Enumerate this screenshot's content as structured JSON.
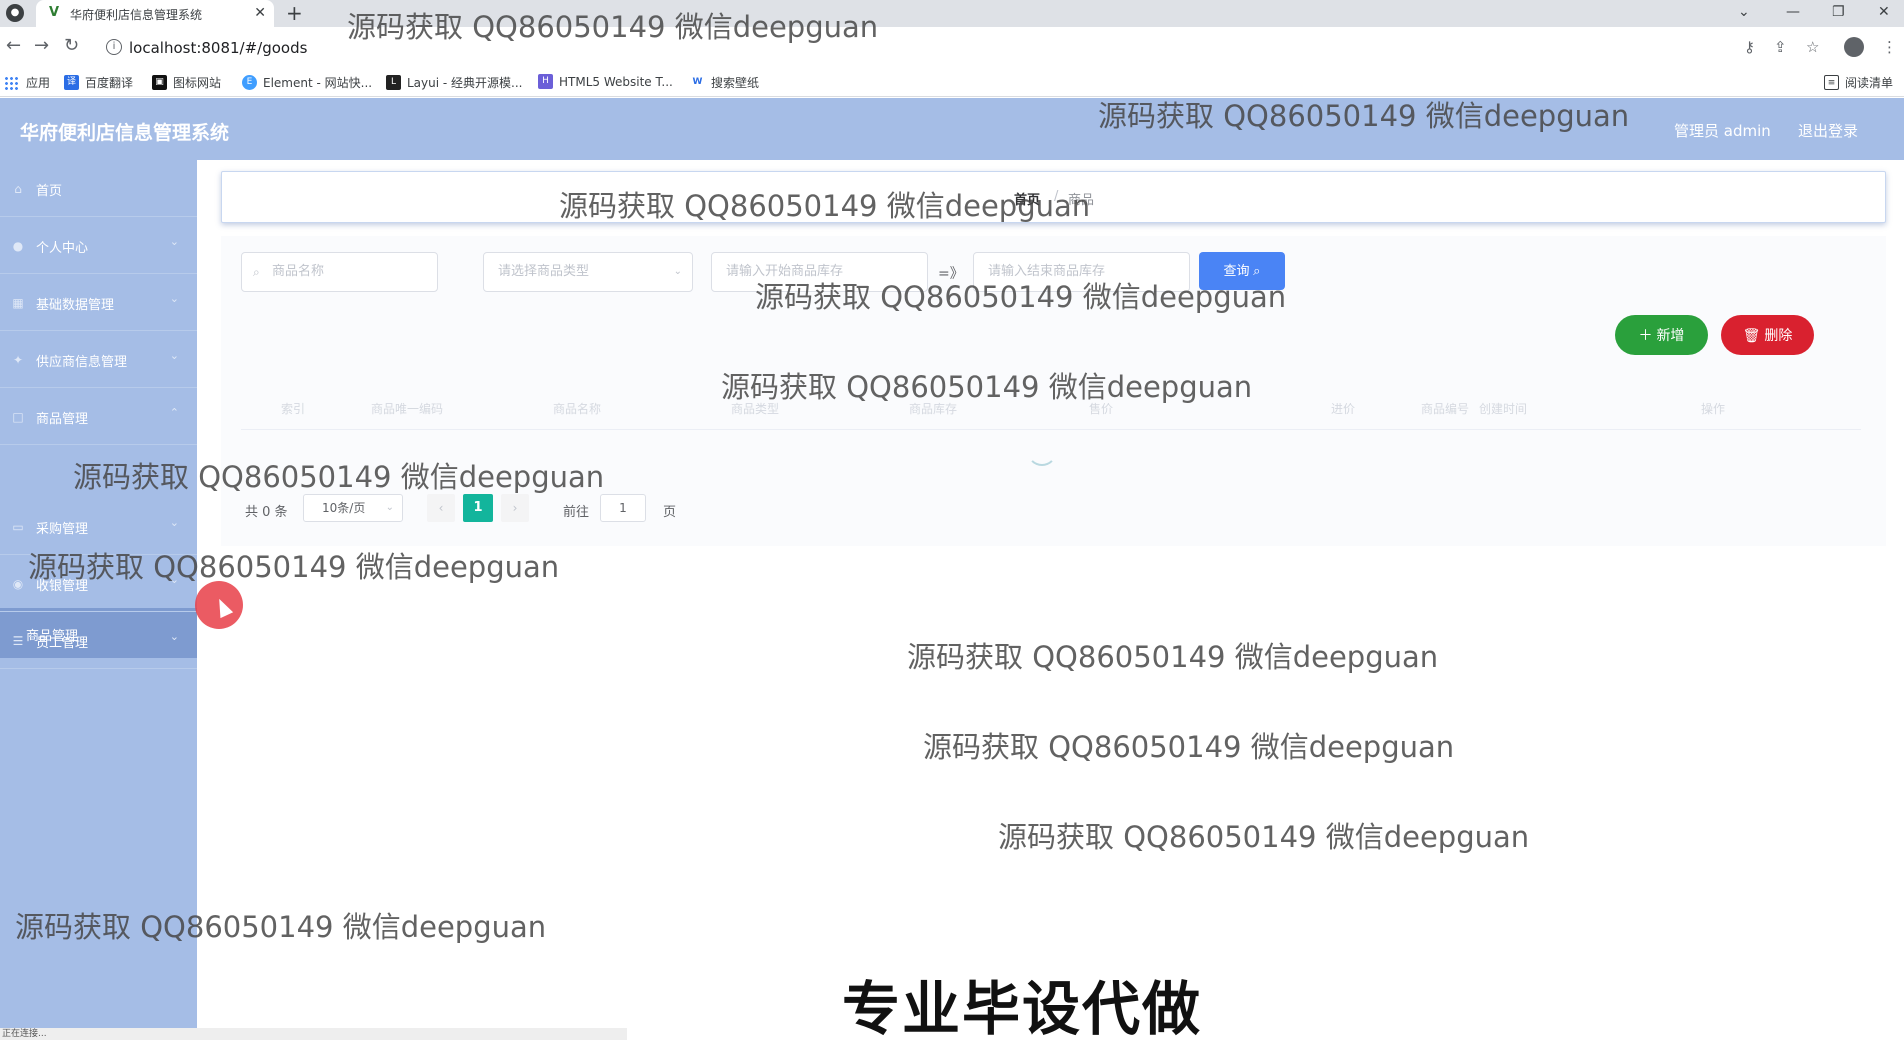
{
  "browser": {
    "tab_title": "华府便利店信息管理系统",
    "tab_close": "✕",
    "new_tab": "+",
    "url": "localhost:8081/#/goods",
    "bookmarks": [
      {
        "label": "应用"
      },
      {
        "label": "百度翻译"
      },
      {
        "label": "图标网站"
      },
      {
        "label": "Element - 网站快..."
      },
      {
        "label": "Layui - 经典开源模..."
      },
      {
        "label": "HTML5 Website T..."
      },
      {
        "label": "搜索壁纸"
      },
      {
        "label": "阅读清单"
      }
    ],
    "status_text": "正在连接..."
  },
  "header": {
    "title": "华府便利店信息管理系统",
    "user": "管理员 admin",
    "logout": "退出登录"
  },
  "sidebar": {
    "items": [
      {
        "label": "首页",
        "icon": "home-icon"
      },
      {
        "label": "个人中心",
        "icon": "user-icon"
      },
      {
        "label": "基础数据管理",
        "icon": "data-icon"
      },
      {
        "label": "供应商信息管理",
        "icon": "supplier-icon"
      },
      {
        "label": "商品管理",
        "icon": "goods-icon"
      },
      {
        "label": "采购管理",
        "icon": "purchase-icon"
      },
      {
        "label": "收银管理",
        "icon": "cashier-icon"
      },
      {
        "label": "员工管理",
        "icon": "staff-icon"
      }
    ],
    "active_sub": "商品管理"
  },
  "breadcrumb": {
    "home": "首页",
    "sep": "/",
    "current": "商品"
  },
  "filters": {
    "name_placeholder": "商品名称",
    "type_placeholder": "请选择商品类型",
    "start_placeholder": "请输入开始商品库存",
    "range_sep": "=》",
    "end_placeholder": "请输入结束商品库存",
    "query_label": "查询"
  },
  "actions": {
    "add_label": "新增",
    "delete_label": "删除"
  },
  "table": {
    "columns": [
      "索引",
      "商品唯一编码",
      "商品名称",
      "商品类型",
      "商品库存",
      "售价",
      "进价",
      "商品编号",
      "创建时间",
      "操作"
    ]
  },
  "pagination": {
    "total": "共 0 条",
    "page_size": "10条/页",
    "prev": "‹",
    "current": "1",
    "next": "›",
    "goto": "前往",
    "goto_value": "1",
    "page_unit": "页"
  },
  "overlay": {
    "watermark": "源码获取 QQ86050149 微信deepguan",
    "caption": "专业毕设代做"
  },
  "colors": {
    "theme": "#a5bde6",
    "query_button": "#4a84f5",
    "add_button": "#2aa03c",
    "delete_button": "#d9212f",
    "pager_active": "#13b59c"
  }
}
